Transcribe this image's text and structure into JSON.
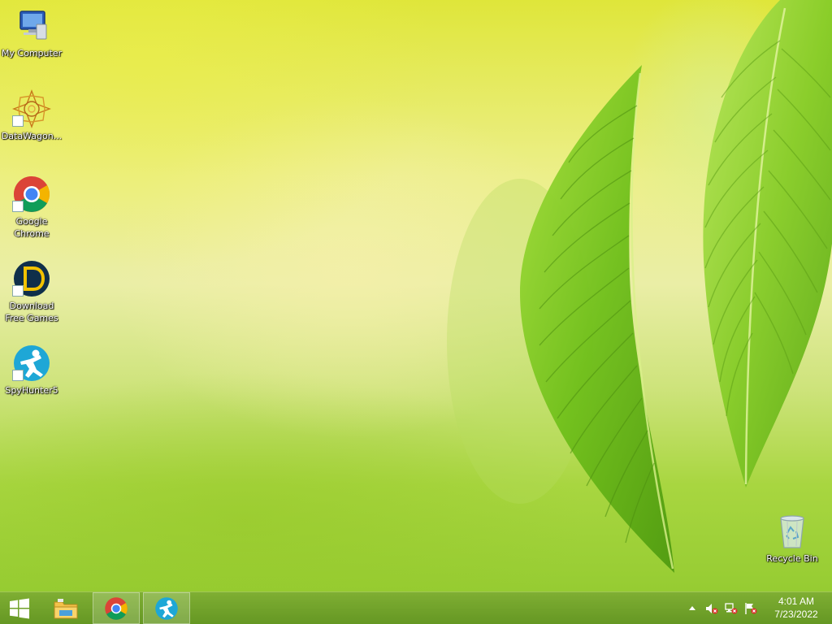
{
  "desktop": {
    "icons": [
      {
        "label": "My Computer",
        "icon": "computer-icon"
      },
      {
        "label": "DataWagon...",
        "icon": "datawagon-icon"
      },
      {
        "label": "Google Chrome",
        "icon": "chrome-icon"
      },
      {
        "label": "Download Free Games",
        "icon": "download-free-games-icon"
      },
      {
        "label": "SpyHunter5",
        "icon": "spyhunter-icon"
      },
      {
        "label": "Recycle Bin",
        "icon": "recycle-bin-icon"
      }
    ]
  },
  "taskbar": {
    "start": {
      "icon": "windows-logo-icon"
    },
    "pinned": [
      {
        "name": "File Explorer",
        "icon": "file-explorer-icon",
        "active": false
      },
      {
        "name": "Google Chrome",
        "icon": "chrome-icon",
        "active": true
      },
      {
        "name": "SpyHunter5",
        "icon": "spyhunter-icon",
        "active": true
      }
    ]
  },
  "tray": {
    "icons": [
      "show-hidden-icons-icon",
      "volume-muted-icon",
      "network-disconnected-icon",
      "action-center-flag-icon"
    ],
    "time": "4:01 AM",
    "date": "7/23/2022"
  },
  "colors": {
    "taskbar": "#6a9c22",
    "desktop_top": "#dfe63a",
    "desktop_bottom": "#96cc32",
    "leaf": "#7ec81e"
  }
}
